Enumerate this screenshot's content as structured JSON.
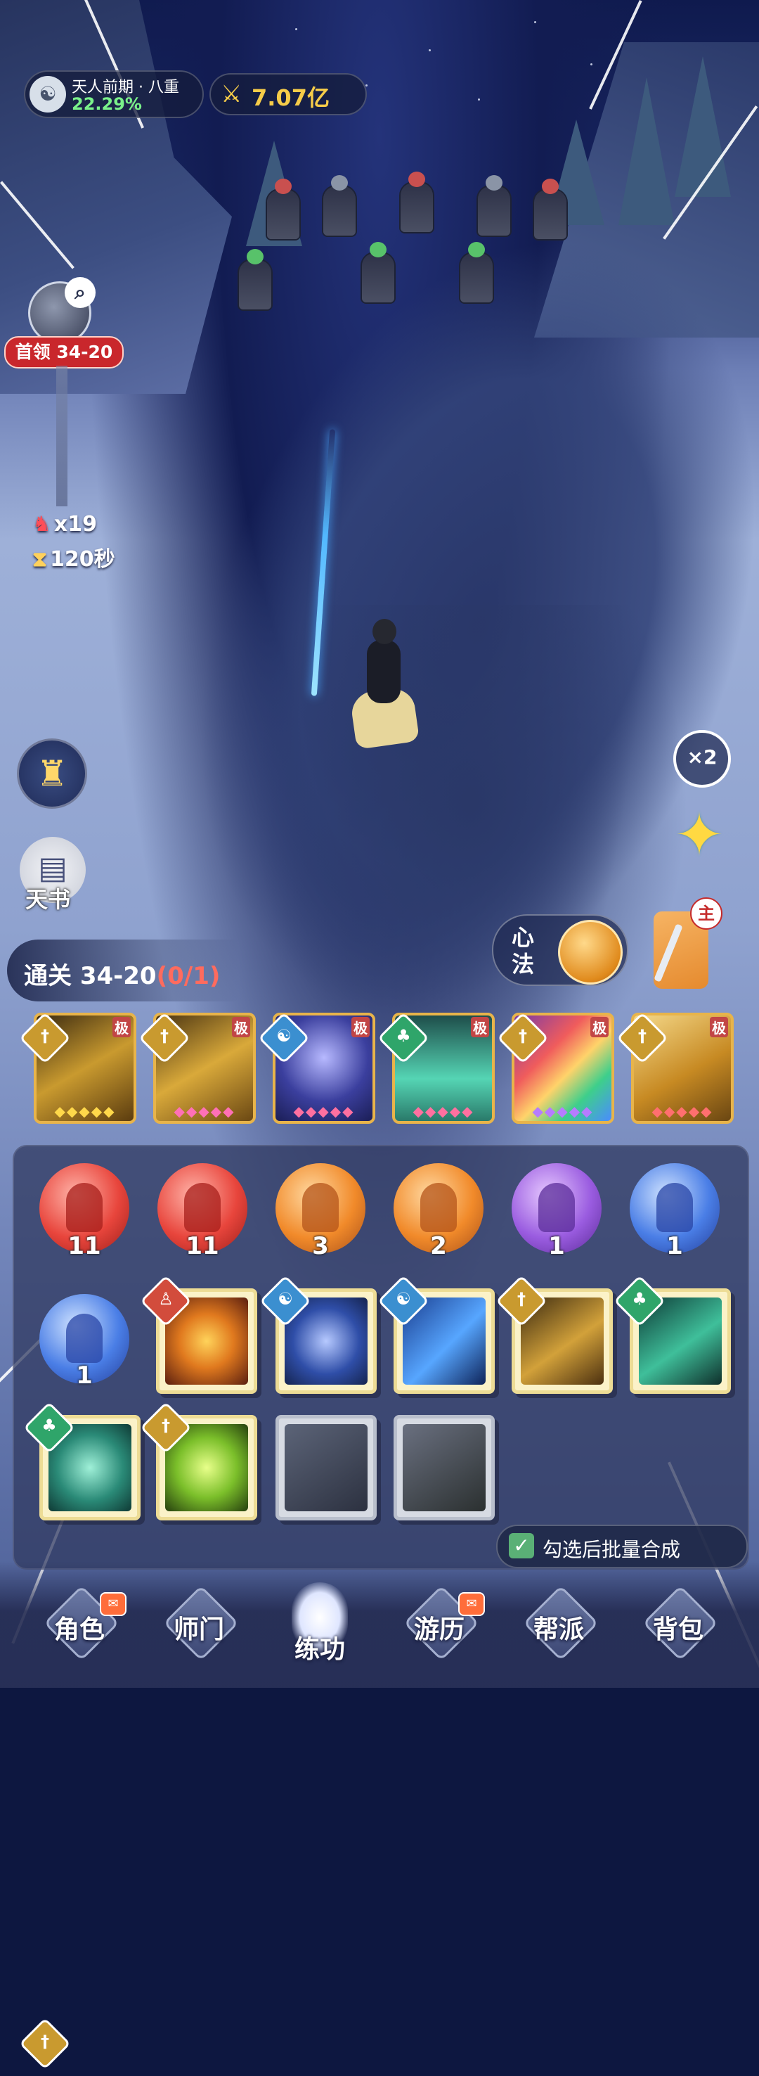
{
  "hud": {
    "realm_name": "天人前期 · 八重",
    "realm_progress": "22.29%",
    "power_value": "7.07亿",
    "boss_label": "首领 34-20",
    "enemy_count": "x19",
    "timer": "120秒"
  },
  "side_buttons": {
    "book_label": "天书",
    "speed_label": "×2"
  },
  "xinfa": {
    "label": "心法",
    "badge": "主"
  },
  "stage": {
    "clear_label": "通关 34-20",
    "clear_progress": "(0/1)"
  },
  "equipped_skills": [
    {
      "tag": "极",
      "element": "sword"
    },
    {
      "tag": "极",
      "element": "sword"
    },
    {
      "tag": "极",
      "element": "taiji"
    },
    {
      "tag": "极",
      "element": "nature"
    },
    {
      "tag": "极",
      "element": "sword"
    },
    {
      "tag": "极",
      "element": "sword"
    }
  ],
  "orbs": [
    {
      "color": "red",
      "count": "11"
    },
    {
      "color": "red",
      "count": "11"
    },
    {
      "color": "orange",
      "count": "3"
    },
    {
      "color": "orange",
      "count": "2"
    },
    {
      "color": "purple",
      "count": "1"
    },
    {
      "color": "blue",
      "count": "1"
    },
    {
      "color": "blue",
      "count": "1"
    }
  ],
  "batch": {
    "label": "勾选后批量合成",
    "checked": true
  },
  "nav": [
    {
      "label": "角色",
      "badge": true
    },
    {
      "label": "师门",
      "badge": false
    },
    {
      "label": "练功",
      "badge": false,
      "active": true
    },
    {
      "label": "游历",
      "badge": true
    },
    {
      "label": "帮派",
      "badge": false
    },
    {
      "label": "背包",
      "badge": false
    }
  ],
  "colors": {
    "progress_green": "#7af28a",
    "power_gold": "#f6cc49",
    "boss_red": "#c9272c",
    "clear_progress_red": "#ff6b5e"
  }
}
